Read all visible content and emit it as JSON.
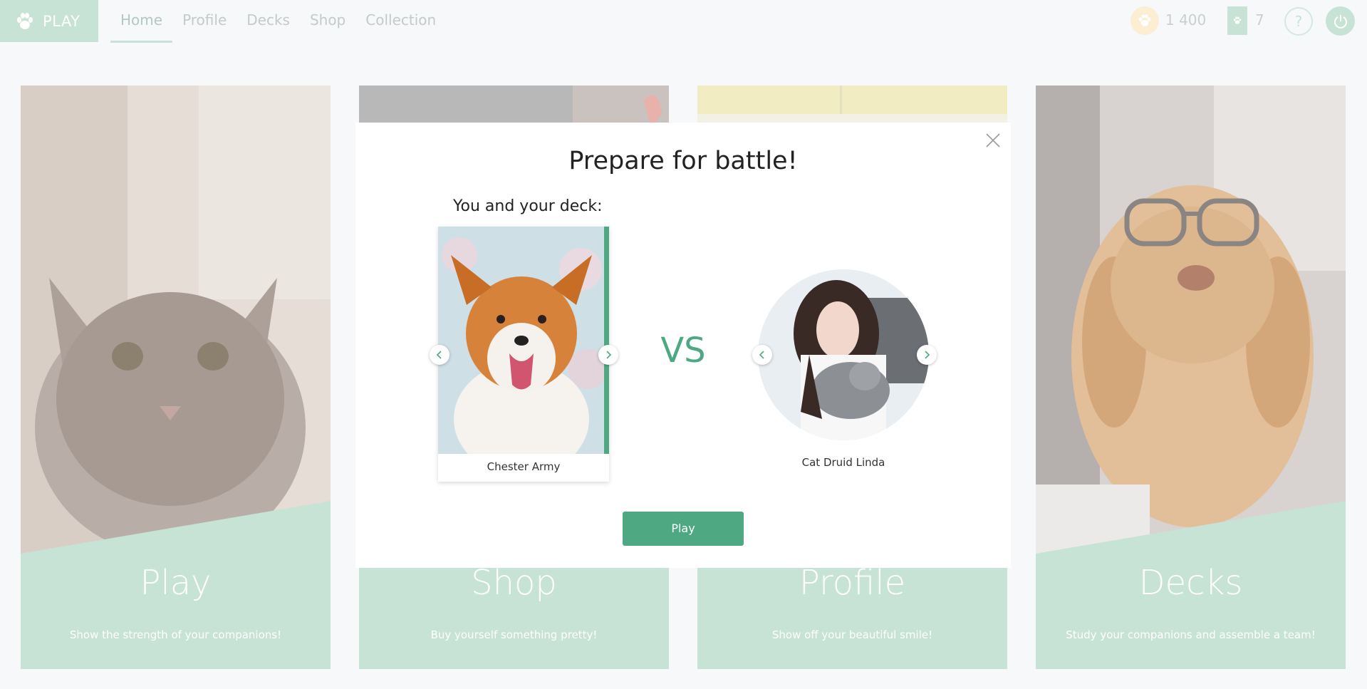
{
  "brand": {
    "label": "PLAY",
    "icon": "paw-icon"
  },
  "nav": {
    "tabs": [
      {
        "label": "Home",
        "active": true
      },
      {
        "label": "Profile",
        "active": false
      },
      {
        "label": "Decks",
        "active": false
      },
      {
        "label": "Shop",
        "active": false
      },
      {
        "label": "Collection",
        "active": false
      }
    ]
  },
  "stats": {
    "coins": "1 400",
    "coin_icon": "paw-coin-icon",
    "packs": "7",
    "pack_icon": "card-pack-icon",
    "help_icon": "question-icon",
    "power_icon": "power-icon"
  },
  "cards": [
    {
      "title": "Play",
      "desc": "Show the strength of your companions!",
      "photo": "cat-photo"
    },
    {
      "title": "Shop",
      "desc": "Buy yourself something pretty!",
      "photo": "shop-photo"
    },
    {
      "title": "Profile",
      "desc": "Show off your beautiful smile!",
      "photo": "profile-photo"
    },
    {
      "title": "Decks",
      "desc": "Study your companions and assemble a team!",
      "photo": "dog-glasses-photo"
    }
  ],
  "modal": {
    "title": "Prepare for battle!",
    "subtitle": "You and your deck:",
    "vs": "VS",
    "deck": {
      "name": "Chester Army",
      "photo": "corgi-photo"
    },
    "opponent": {
      "name": "Cat Druid Linda",
      "photo": "woman-with-cat-photo"
    },
    "play_label": "Play"
  },
  "colors": {
    "accent": "#4ea982",
    "mint": "#c6e3d6",
    "background": "#f7f8fa"
  }
}
